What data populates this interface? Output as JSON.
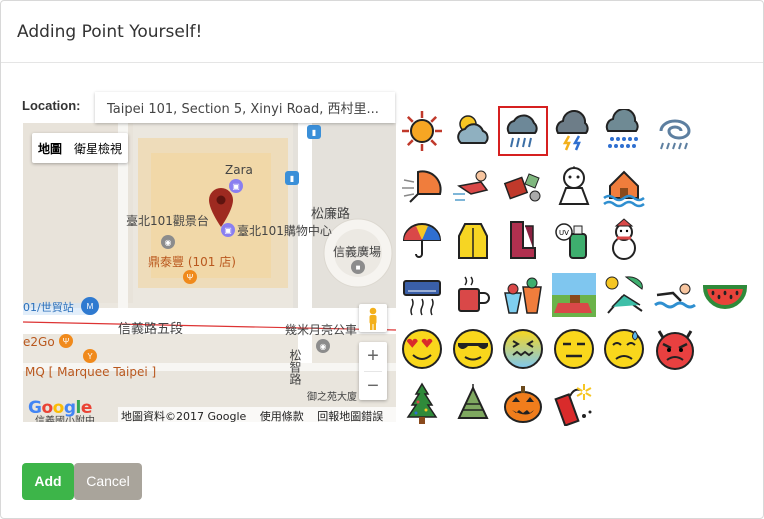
{
  "modal": {
    "title": "Adding Point Yourself!"
  },
  "location": {
    "label": "Location:",
    "value": "Taipei 101, Section 5, Xinyi Road, 西村里..."
  },
  "map": {
    "type_map_label": "地圖",
    "type_satellite_label": "衛星檢視",
    "labels": {
      "zara": "Zara",
      "observatory": "臺北101觀景台",
      "mall": "臺北101購物中心",
      "songlian": "松廉路",
      "xinyi_plaza": "信義廣場",
      "dintaifung": "鼎泰豐 (101 店)",
      "world_trade": "01/世貿站",
      "xinyi_rd": "信義路五段",
      "jimi": "幾米月亮公車",
      "e2go": "e2Go",
      "songzhi": "松智路",
      "marquee": "MQ [ Marquee Taipei ]",
      "hotel": "御之苑大廈",
      "bottom_left": "信義國小附中"
    },
    "google_logo": "Google",
    "footer": {
      "copyright": "地圖資料©2017 Google",
      "terms": "使用條款",
      "report": "回報地圖錯誤"
    },
    "zoom_in": "+",
    "zoom_out": "−"
  },
  "icons": [
    {
      "name": "sunny-icon"
    },
    {
      "name": "partly-cloudy-icon"
    },
    {
      "name": "rain-cloud-icon",
      "selected": true
    },
    {
      "name": "thunderstorm-icon"
    },
    {
      "name": "heavy-rain-icon"
    },
    {
      "name": "typhoon-icon"
    },
    {
      "name": "windy-umbrella-icon"
    },
    {
      "name": "person-blown-away-icon"
    },
    {
      "name": "flying-debris-icon"
    },
    {
      "name": "teru-teru-bozu-icon"
    },
    {
      "name": "flooded-house-icon"
    },
    {
      "name": "umbrella-icon"
    },
    {
      "name": "raincoat-icon"
    },
    {
      "name": "rain-boots-icon"
    },
    {
      "name": "sunscreen-icon"
    },
    {
      "name": "snowman-icon"
    },
    {
      "name": "air-conditioner-icon"
    },
    {
      "name": "hot-drink-icon"
    },
    {
      "name": "cold-drinks-icon"
    },
    {
      "name": "picnic-icon"
    },
    {
      "name": "beach-chair-icon"
    },
    {
      "name": "swimming-icon"
    },
    {
      "name": "watermelon-icon"
    },
    {
      "name": "heart-eyes-face-icon"
    },
    {
      "name": "sunglasses-face-icon"
    },
    {
      "name": "freezing-face-icon"
    },
    {
      "name": "expressionless-face-icon"
    },
    {
      "name": "sweaty-face-icon"
    },
    {
      "name": "angry-devil-face-icon"
    },
    {
      "name": "christmas-tree-icon"
    },
    {
      "name": "zongzi-icon"
    },
    {
      "name": "jack-o-lantern-icon"
    },
    {
      "name": "firecracker-icon"
    }
  ],
  "buttons": {
    "add": "Add",
    "cancel": "Cancel"
  },
  "colors": {
    "add_button": "#3db549",
    "cancel_button": "#a9a49b",
    "selected_outline": "#d62020",
    "marker": "#9e2a20"
  }
}
